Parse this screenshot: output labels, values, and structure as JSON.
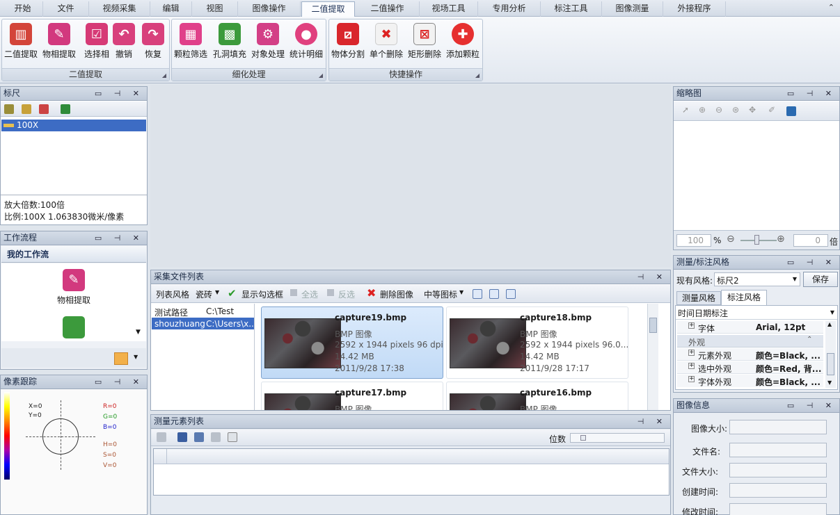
{
  "tabs": [
    "开始",
    "文件",
    "视频采集",
    "编辑",
    "视图",
    "图像操作",
    "二值提取",
    "二值操作",
    "视场工具",
    "专用分析",
    "标注工具",
    "图像测量",
    "外接程序"
  ],
  "active_tab": "二值提取",
  "ribbon": {
    "groups": [
      {
        "title": "二值提取",
        "buttons": [
          "二值提取",
          "物相提取",
          "选择相",
          "撤销",
          "恢复"
        ]
      },
      {
        "title": "细化处理",
        "buttons": [
          "颗粒筛选",
          "孔洞填充",
          "对象处理",
          "统计明细"
        ]
      },
      {
        "title": "快捷操作",
        "buttons": [
          "物体分割",
          "单个删除",
          "矩形删除",
          "添加颗粒"
        ]
      }
    ]
  },
  "ruler_panel": {
    "title": "标尺",
    "item": "100X",
    "magnification": "放大倍数:100倍",
    "scale": "比例:100X 1.063830微米/像素"
  },
  "workflow_panel": {
    "title": "工作流程",
    "header": "我的工作流",
    "item": "物相提取"
  },
  "pixel_panel": {
    "title": "像素跟踪",
    "x": "X=0",
    "y": "Y=0",
    "r": "R=0",
    "g": "G=0",
    "b": "B=0",
    "h": "H=0",
    "s": "S=0",
    "v": "V=0"
  },
  "thumbnail_panel": {
    "title": "缩略图",
    "zoom_value": "100",
    "zoom_unit": "%",
    "times_value": "0",
    "times_unit": "倍"
  },
  "style_panel": {
    "title": "测量/标注风格",
    "current_label": "现有风格:",
    "current_value": "标尺2",
    "save": "保存",
    "tab1": "测量风格",
    "tab2": "标注风格",
    "dropdown": "时间日期标注",
    "rows": [
      {
        "name": "字体",
        "value": "Arial, 12pt"
      },
      {
        "name": "外观",
        "value": ""
      },
      {
        "name": "元素外观",
        "value": "颜色=Black, ..."
      },
      {
        "name": "选中外观",
        "value": "颜色=Red, 背..."
      },
      {
        "name": "字体外观",
        "value": "颜色=Black, ..."
      }
    ]
  },
  "image_info": {
    "title": "图像信息",
    "fields": [
      "图像大小:",
      "文件名:",
      "文件大小:",
      "创建时间:",
      "修改时间:"
    ]
  },
  "files_panel": {
    "title": "采集文件列表",
    "toolbar": [
      "列表风格",
      "瓷砖",
      "显示勾选框",
      "全选",
      "反选",
      "删除图像",
      "中等图标"
    ],
    "paths": [
      {
        "name": "测试路径",
        "path": "C:\\Test"
      },
      {
        "name": "shouzhuang",
        "path": "C:\\Users\\x..."
      }
    ],
    "files": [
      {
        "name": "capture19.bmp",
        "type": "BMP 图像",
        "dims": "2592 x 1944 pixels 96 dpi",
        "size": "14.42 MB",
        "date": "2011/9/28 17:38"
      },
      {
        "name": "capture18.bmp",
        "type": "BMP 图像",
        "dims": "2592 x 1944 pixels 96.0...",
        "size": "14.42 MB",
        "date": "2011/9/28 17:17"
      },
      {
        "name": "capture17.bmp",
        "type": "BMP 图像",
        "dims": "",
        "size": "",
        "date": ""
      },
      {
        "name": "capture16.bmp",
        "type": "BMP 图像",
        "dims": "",
        "size": "",
        "date": ""
      }
    ]
  },
  "measure_panel": {
    "title": "测量元素列表",
    "digits_label": "位数"
  },
  "colors": {
    "accent": "#3d6cc4",
    "selection": "#cfe3f9",
    "header": "#c8d2e0"
  }
}
